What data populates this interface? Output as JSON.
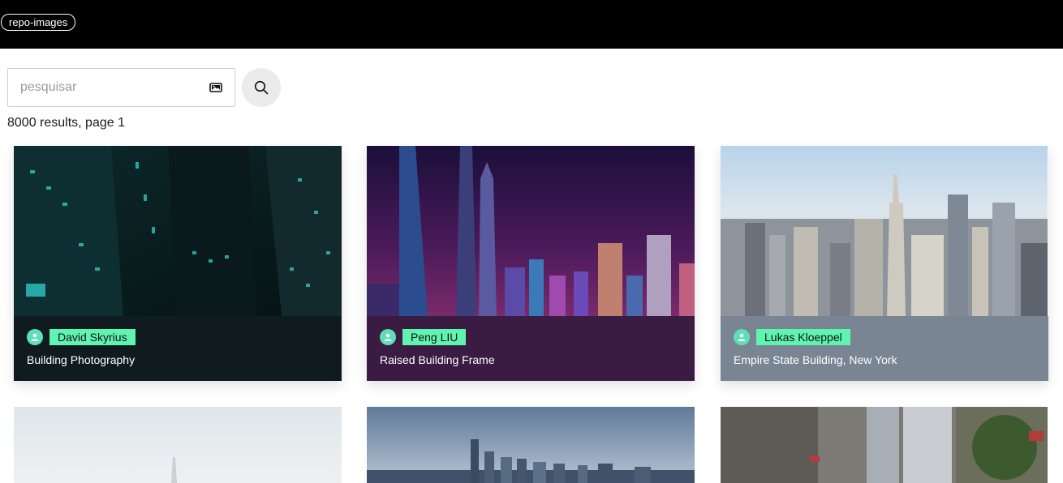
{
  "header": {
    "logo_label": "repo-images"
  },
  "search": {
    "placeholder": "pesquisar",
    "value": ""
  },
  "results": {
    "summary": "8000 results, page 1"
  },
  "cards": [
    {
      "author": "David Skyrius",
      "title": "Building Photography",
      "info_bg": "#0f1b1f"
    },
    {
      "author": "Peng LIU",
      "title": "Raised Building Frame",
      "info_bg": "#3a1c42"
    },
    {
      "author": "Lukas Kloeppel",
      "title": "Empire State Building, New York",
      "info_bg": "#7a8593"
    }
  ],
  "colors": {
    "topbar": "#000000",
    "author_tag": "#5ff5b0",
    "avatar": "#5de0b5"
  }
}
